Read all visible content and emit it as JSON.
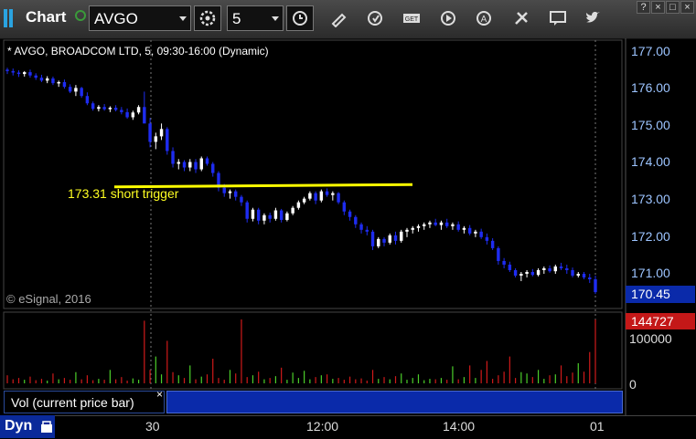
{
  "toolbar": {
    "title": "Chart",
    "symbol": "AVGO",
    "interval": "5",
    "icons": [
      "grip-icon",
      "link-icon",
      "settings-icon",
      "clock-icon",
      "pencil-icon",
      "refresh-icon",
      "get-icon",
      "play-icon",
      "alert-icon",
      "tools-icon",
      "comment-icon",
      "twitter-icon"
    ],
    "window_buttons": [
      "?",
      "×",
      "□",
      "×"
    ]
  },
  "chart": {
    "header": "* AVGO, BROADCOM LTD, 5, 09:30-16:00 (Dynamic)",
    "copyright": "© eSignal, 2016",
    "annotation": "173.31 short trigger",
    "last_price": "170.45",
    "last_volume": "144727",
    "y_ticks": [
      "177.00",
      "176.00",
      "175.00",
      "174.00",
      "173.00",
      "172.00",
      "171.00"
    ],
    "vol_ticks": [
      "100000",
      "0"
    ],
    "x_ticks": [
      "30",
      "12:00",
      "14:00",
      "01"
    ],
    "vol_legend": "Vol (current price bar)",
    "vol_legend_close": "×",
    "dyn_label": "Dyn",
    "colors": {
      "up": "#ffffff",
      "down": "#1e2cf0",
      "trigger": "#ffff00",
      "vol_up": "#4ccf2a",
      "vol_down": "#d01a1a"
    }
  },
  "chart_data": {
    "type": "candlestick",
    "title": "AVGO, BROADCOM LTD, 5, 09:30-16:00 (Dynamic)",
    "ylim": [
      170.2,
      177.3
    ],
    "x_ticks": [
      "30",
      "12:00",
      "14:00",
      "01"
    ],
    "trigger": {
      "value": 173.31,
      "label": "173.31 short trigger"
    },
    "last_price": 170.45,
    "last_volume": 144727,
    "candles": [
      [
        176.52,
        176.57,
        176.4,
        176.48
      ],
      [
        176.48,
        176.55,
        176.36,
        176.44
      ],
      [
        176.44,
        176.5,
        176.32,
        176.4
      ],
      [
        176.4,
        176.48,
        176.33,
        176.45
      ],
      [
        176.45,
        176.52,
        176.3,
        176.36
      ],
      [
        176.36,
        176.42,
        176.24,
        176.3
      ],
      [
        176.3,
        176.38,
        176.18,
        176.22
      ],
      [
        176.22,
        176.34,
        176.15,
        176.28
      ],
      [
        176.28,
        176.33,
        176.1,
        176.15
      ],
      [
        176.15,
        176.22,
        176.05,
        176.18
      ],
      [
        176.18,
        176.25,
        176.0,
        176.05
      ],
      [
        176.05,
        176.12,
        175.88,
        175.92
      ],
      [
        175.92,
        176.1,
        175.8,
        176.02
      ],
      [
        176.02,
        176.05,
        175.75,
        175.8
      ],
      [
        175.8,
        175.9,
        175.55,
        175.6
      ],
      [
        175.6,
        175.65,
        175.4,
        175.45
      ],
      [
        175.45,
        175.55,
        175.38,
        175.5
      ],
      [
        175.5,
        175.58,
        175.4,
        175.44
      ],
      [
        175.44,
        175.52,
        175.36,
        175.48
      ],
      [
        175.48,
        175.55,
        175.38,
        175.42
      ],
      [
        175.42,
        175.5,
        175.3,
        175.36
      ],
      [
        175.36,
        175.46,
        175.18,
        175.22
      ],
      [
        175.22,
        175.4,
        175.15,
        175.35
      ],
      [
        175.35,
        175.55,
        175.3,
        175.5
      ],
      [
        175.5,
        175.92,
        175.45,
        175.05
      ],
      [
        175.05,
        175.2,
        174.4,
        174.55
      ],
      [
        174.55,
        174.8,
        174.35,
        174.7
      ],
      [
        174.7,
        175.05,
        174.6,
        174.9
      ],
      [
        174.9,
        174.95,
        174.2,
        174.3
      ],
      [
        174.3,
        174.4,
        173.85,
        173.95
      ],
      [
        173.95,
        174.08,
        173.8,
        174.0
      ],
      [
        174.0,
        174.05,
        173.75,
        173.85
      ],
      [
        173.85,
        174.08,
        173.75,
        174.0
      ],
      [
        174.0,
        174.08,
        173.7,
        173.8
      ],
      [
        173.8,
        174.15,
        173.75,
        174.1
      ],
      [
        174.1,
        174.15,
        173.9,
        173.95
      ],
      [
        173.95,
        174.0,
        173.6,
        173.7
      ],
      [
        173.7,
        173.75,
        173.2,
        173.3
      ],
      [
        173.3,
        173.4,
        173.05,
        173.15
      ],
      [
        173.15,
        173.25,
        173.0,
        173.2
      ],
      [
        173.2,
        173.25,
        172.95,
        173.05
      ],
      [
        173.05,
        173.1,
        172.8,
        172.9
      ],
      [
        172.9,
        172.95,
        172.35,
        172.45
      ],
      [
        172.45,
        172.75,
        172.38,
        172.7
      ],
      [
        172.7,
        172.75,
        172.3,
        172.4
      ],
      [
        172.4,
        172.6,
        172.3,
        172.55
      ],
      [
        172.55,
        172.62,
        172.35,
        172.45
      ],
      [
        172.45,
        172.75,
        172.4,
        172.68
      ],
      [
        172.68,
        172.72,
        172.35,
        172.42
      ],
      [
        172.42,
        172.65,
        172.38,
        172.6
      ],
      [
        172.6,
        172.8,
        172.55,
        172.75
      ],
      [
        172.75,
        172.95,
        172.7,
        172.9
      ],
      [
        172.9,
        173.05,
        172.85,
        173.0
      ],
      [
        173.0,
        173.2,
        172.95,
        173.15
      ],
      [
        173.15,
        173.2,
        172.85,
        172.95
      ],
      [
        172.95,
        173.25,
        172.9,
        173.2
      ],
      [
        173.2,
        173.28,
        173.05,
        173.1
      ],
      [
        173.1,
        173.2,
        172.95,
        173.15
      ],
      [
        173.15,
        173.18,
        172.85,
        172.9
      ],
      [
        172.9,
        172.95,
        172.55,
        172.65
      ],
      [
        172.65,
        172.7,
        172.4,
        172.5
      ],
      [
        172.5,
        172.55,
        172.2,
        172.3
      ],
      [
        172.3,
        172.35,
        172.05,
        172.15
      ],
      [
        172.15,
        172.25,
        172.0,
        172.1
      ],
      [
        172.1,
        172.15,
        171.6,
        171.7
      ],
      [
        171.7,
        171.95,
        171.65,
        171.9
      ],
      [
        171.9,
        171.95,
        171.7,
        171.8
      ],
      [
        171.8,
        172.05,
        171.75,
        172.0
      ],
      [
        172.0,
        172.1,
        171.75,
        171.85
      ],
      [
        171.85,
        172.15,
        171.8,
        172.1
      ],
      [
        172.1,
        172.2,
        171.95,
        172.15
      ],
      [
        172.15,
        172.25,
        172.05,
        172.2
      ],
      [
        172.2,
        172.3,
        172.1,
        172.25
      ],
      [
        172.25,
        172.35,
        172.15,
        172.3
      ],
      [
        172.3,
        172.4,
        172.2,
        172.35
      ],
      [
        172.35,
        172.45,
        172.25,
        172.28
      ],
      [
        172.28,
        172.4,
        172.15,
        172.35
      ],
      [
        172.35,
        172.45,
        172.2,
        172.25
      ],
      [
        172.25,
        172.35,
        172.15,
        172.3
      ],
      [
        172.3,
        172.38,
        172.1,
        172.15
      ],
      [
        172.15,
        172.25,
        172.05,
        172.2
      ],
      [
        172.2,
        172.28,
        172.0,
        172.05
      ],
      [
        172.05,
        172.15,
        171.95,
        172.1
      ],
      [
        172.1,
        172.18,
        171.9,
        171.95
      ],
      [
        171.95,
        172.05,
        171.75,
        171.85
      ],
      [
        171.85,
        171.92,
        171.6,
        171.65
      ],
      [
        171.65,
        171.7,
        171.2,
        171.3
      ],
      [
        171.3,
        171.38,
        171.1,
        171.2
      ],
      [
        171.2,
        171.28,
        171.0,
        171.05
      ],
      [
        171.05,
        171.1,
        170.85,
        170.9
      ],
      [
        170.9,
        171.0,
        170.75,
        170.95
      ],
      [
        170.95,
        171.05,
        170.85,
        171.0
      ],
      [
        171.0,
        171.08,
        170.88,
        170.92
      ],
      [
        170.92,
        171.1,
        170.88,
        171.05
      ],
      [
        171.05,
        171.15,
        170.95,
        171.1
      ],
      [
        171.1,
        171.18,
        170.98,
        171.02
      ],
      [
        171.02,
        171.2,
        170.95,
        171.15
      ],
      [
        171.15,
        171.25,
        171.05,
        171.1
      ],
      [
        171.1,
        171.2,
        170.95,
        171.05
      ],
      [
        171.05,
        171.12,
        170.85,
        170.9
      ],
      [
        170.9,
        171.0,
        170.85,
        170.95
      ],
      [
        170.95,
        171.0,
        170.8,
        170.85
      ],
      [
        170.85,
        170.95,
        170.7,
        170.8
      ],
      [
        170.8,
        170.9,
        170.4,
        170.45
      ]
    ],
    "volumes": [
      18000,
      9000,
      12000,
      8000,
      15000,
      7000,
      10000,
      6000,
      22000,
      9000,
      12000,
      8000,
      25000,
      9000,
      18000,
      7000,
      10000,
      8000,
      30000,
      9000,
      14000,
      6000,
      11000,
      8000,
      140000,
      30000,
      60000,
      20000,
      95000,
      25000,
      18000,
      12000,
      40000,
      9000,
      15000,
      20000,
      55000,
      12000,
      8000,
      30000,
      22000,
      175000,
      14000,
      18000,
      26000,
      9000,
      12000,
      16000,
      35000,
      8000,
      24000,
      12000,
      28000,
      9000,
      14000,
      18000,
      20000,
      10000,
      12000,
      8000,
      15000,
      9000,
      11000,
      6000,
      30000,
      10000,
      14000,
      9000,
      16000,
      22000,
      8000,
      12000,
      20000,
      7000,
      10000,
      9000,
      12000,
      8000,
      38000,
      9000,
      14000,
      40000,
      12000,
      30000,
      50000,
      10000,
      18000,
      26000,
      60000,
      12000,
      25000,
      22000,
      14000,
      30000,
      10000,
      18000,
      20000,
      40000,
      16000,
      24000,
      45000,
      26000,
      70000,
      175000
    ]
  }
}
